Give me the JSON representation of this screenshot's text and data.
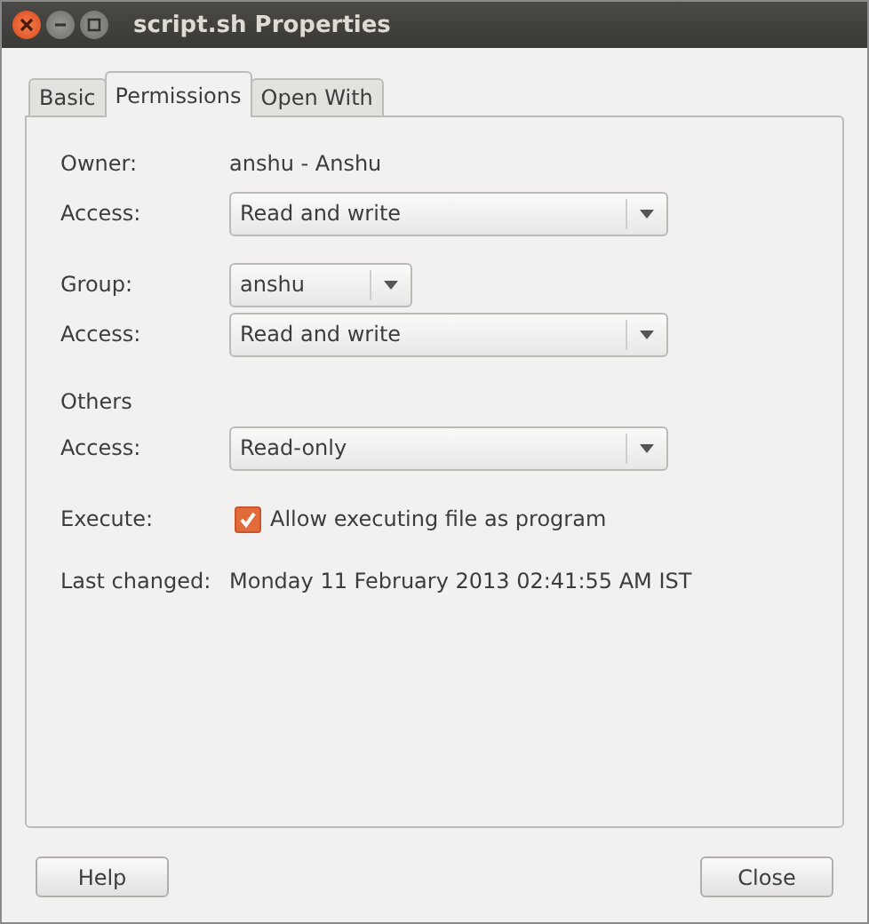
{
  "window": {
    "title": "script.sh Properties"
  },
  "tabs": [
    {
      "label": "Basic",
      "selected": false
    },
    {
      "label": "Permissions",
      "selected": true
    },
    {
      "label": "Open With",
      "selected": false
    }
  ],
  "rows": [
    {
      "kind": "text",
      "label": "Owner:",
      "value": "anshu - Anshu"
    },
    {
      "kind": "combo",
      "label": "Access:",
      "value": "Read and write",
      "wide": true
    },
    {
      "kind": "combo",
      "label": "Group:",
      "value": "anshu",
      "wide": false
    },
    {
      "kind": "combo",
      "label": "Access:",
      "value": "Read and write",
      "wide": true
    },
    {
      "kind": "heading",
      "label": "Others"
    },
    {
      "kind": "combo",
      "label": "Access:",
      "value": "Read-only",
      "wide": true
    },
    {
      "kind": "checkbox",
      "label": "Execute:",
      "value": "Allow executing file as program",
      "checked": true
    },
    {
      "kind": "text",
      "label": "Last changed:",
      "value": "Monday 11 February 2013 02:41:55 AM IST"
    }
  ],
  "buttons": [
    {
      "label": "Help"
    },
    {
      "label": "Close"
    }
  ]
}
